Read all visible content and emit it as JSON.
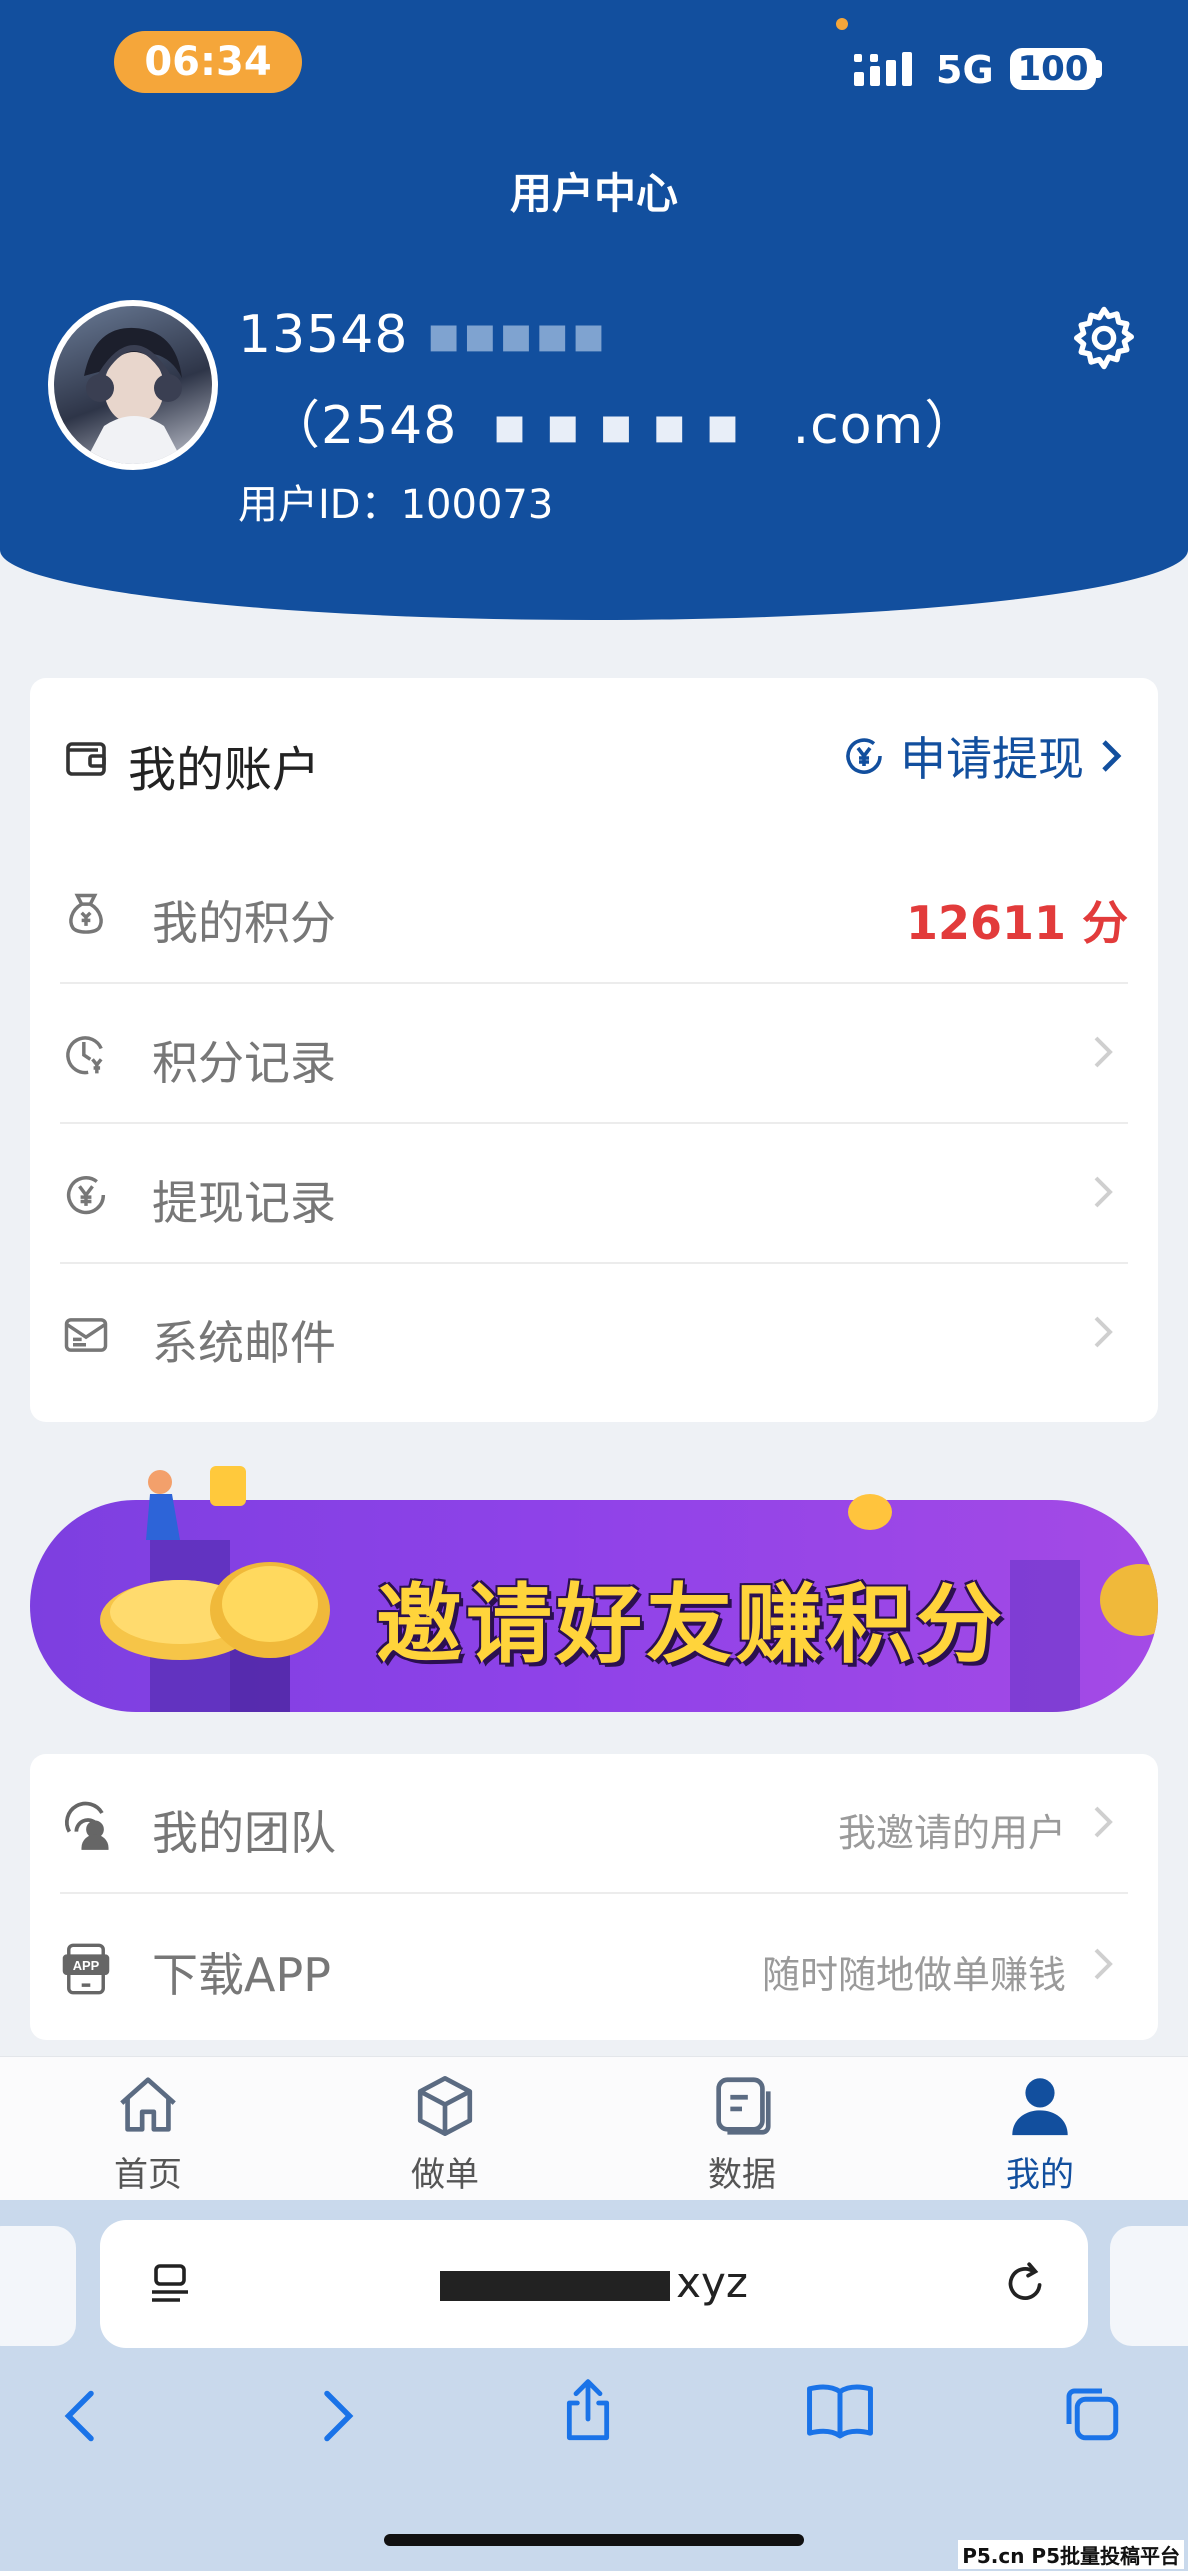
{
  "status_bar": {
    "time": "06:34",
    "network": "5G",
    "battery": "100"
  },
  "header": {
    "title": "用户中心",
    "user_phone": "13548",
    "user_email_prefix": "（2548",
    "user_email_suffix": ".com）",
    "user_id": "用户ID：100073"
  },
  "account": {
    "title": "我的账户",
    "withdraw_label": "申请提现",
    "rows": [
      {
        "label": "我的积分",
        "value": "12611 分",
        "icon": "money-bag-icon"
      },
      {
        "label": "积分记录",
        "icon": "clock-yen-icon"
      },
      {
        "label": "提现记录",
        "icon": "yen-circle-icon"
      },
      {
        "label": "系统邮件",
        "icon": "mail-icon"
      }
    ]
  },
  "banner": {
    "text": "邀请好友赚积分"
  },
  "team": {
    "rows": [
      {
        "label": "我的团队",
        "hint": "我邀请的用户",
        "icon": "team-icon"
      },
      {
        "label": "下载APP",
        "hint": "随时随地做单赚钱",
        "icon": "app-icon",
        "icon_text": "APP"
      }
    ]
  },
  "tabbar": {
    "tabs": [
      {
        "label": "首页",
        "icon": "home-icon"
      },
      {
        "label": "做单",
        "icon": "box-icon"
      },
      {
        "label": "数据",
        "icon": "data-icon"
      },
      {
        "label": "我的",
        "icon": "user-icon",
        "active": true
      }
    ]
  },
  "browser": {
    "url": "xyz",
    "url_suffix_visible": "xyz"
  },
  "watermark": "P5.cn P5批量投稿平台",
  "colors": {
    "brand_blue": "#124f9e",
    "accent_orange": "#f5a63a",
    "points_red": "#e23b3b",
    "banner_purple": "#8e42e8"
  }
}
